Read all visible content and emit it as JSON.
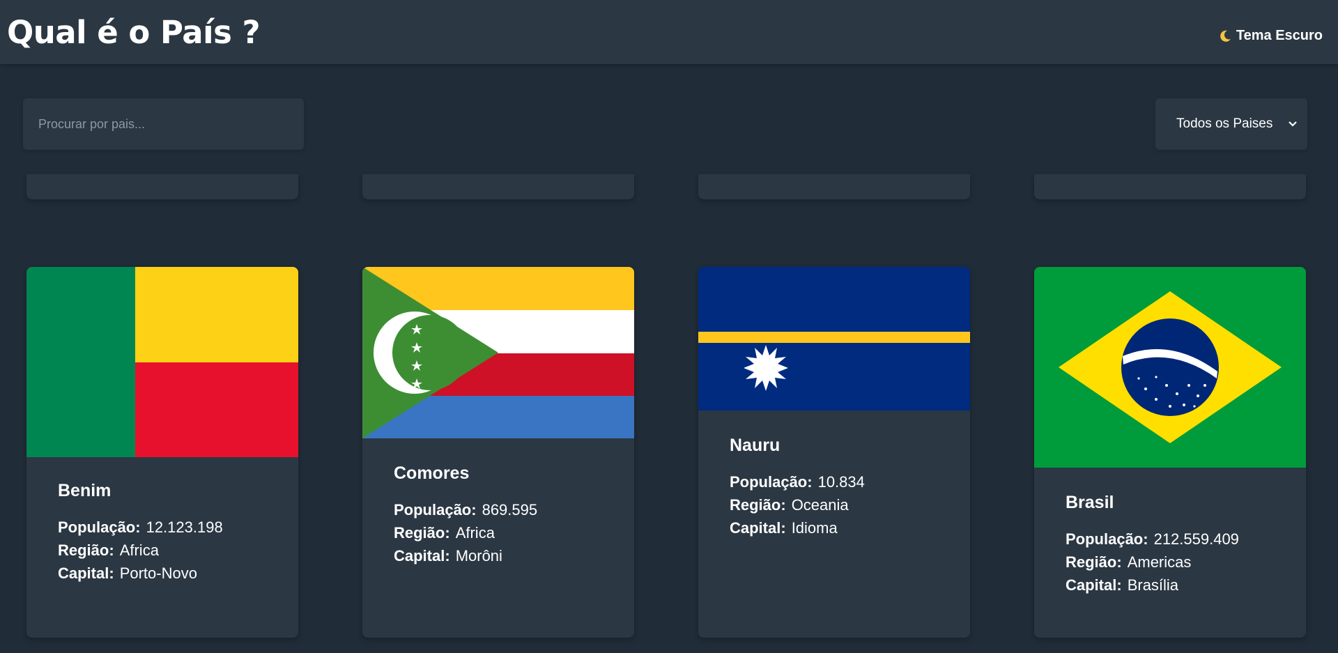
{
  "header": {
    "title": "Qual é o País ?",
    "theme_label": "Tema Escuro",
    "theme_icon": "moon-icon"
  },
  "search": {
    "placeholder": "Procurar por pais..."
  },
  "filter": {
    "selected": "Todos os Paises",
    "icon": "chevron-down-icon"
  },
  "labels": {
    "population": "População:",
    "region": "Região:",
    "capital": "Capital:"
  },
  "countries": [
    {
      "name": "Benim",
      "population": "12.123.198",
      "region": "Africa",
      "capital": "Porto-Novo"
    },
    {
      "name": "Comores",
      "population": "869.595",
      "region": "Africa",
      "capital": "Morôni"
    },
    {
      "name": "Nauru",
      "population": "10.834",
      "region": "Oceania",
      "capital": "Idioma"
    },
    {
      "name": "Brasil",
      "population": "212.559.409",
      "region": "Americas",
      "capital": "Brasília"
    }
  ],
  "colors": {
    "background": "#202c37",
    "surface": "#2b3743",
    "text": "#ffffff"
  }
}
